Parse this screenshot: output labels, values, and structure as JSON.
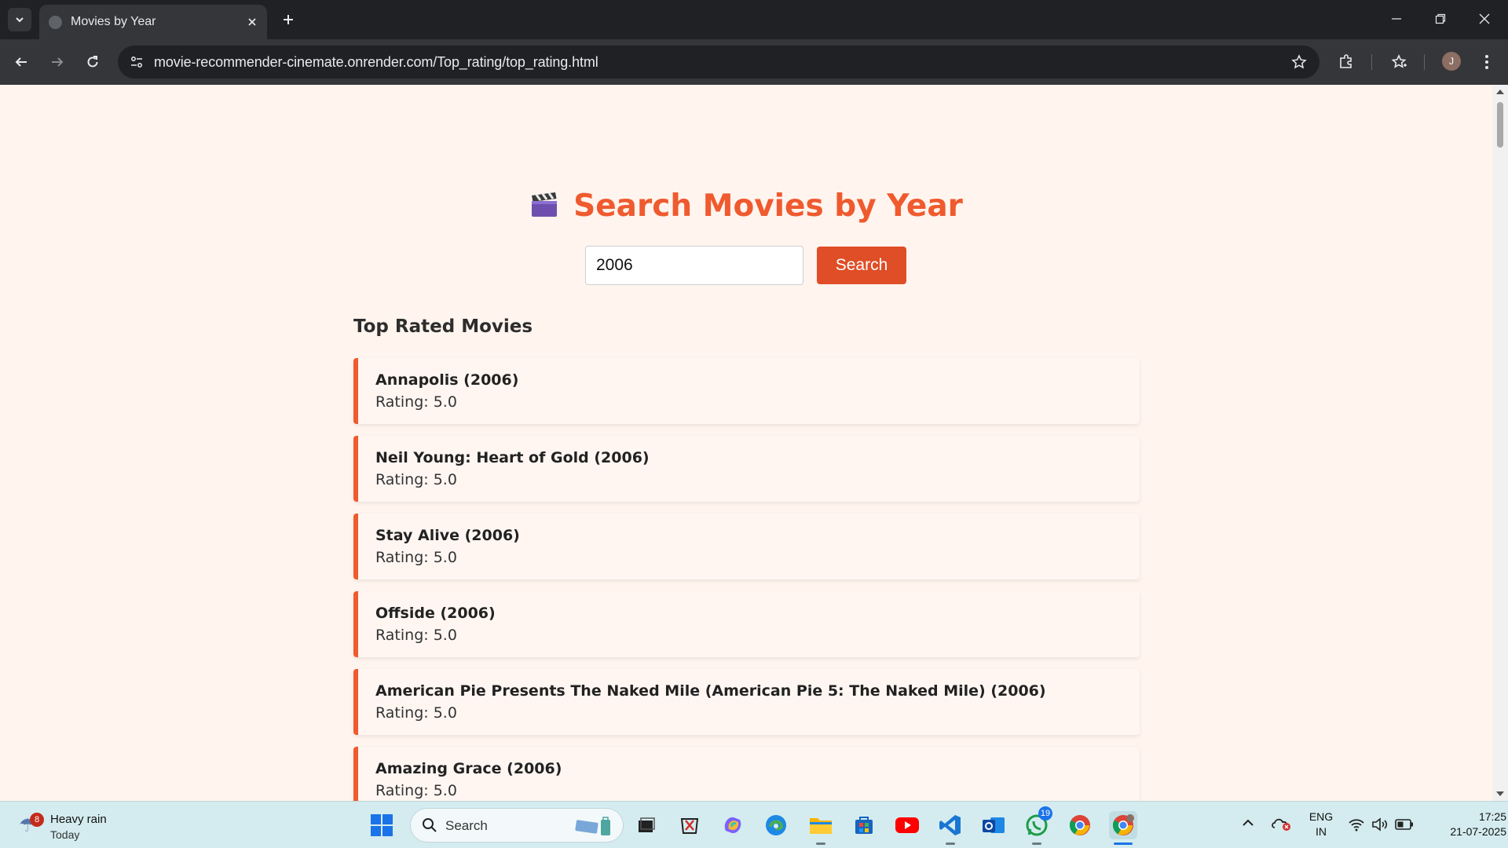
{
  "browser": {
    "tab_title": "Movies by Year",
    "url": "movie-recommender-cinemate.onrender.com/Top_rating/top_rating.html",
    "profile_initial": "J"
  },
  "page": {
    "heading": "Search Movies by Year",
    "heading_icon": "clapper-board-icon",
    "search_value": "2006",
    "search_button": "Search",
    "section_title": "Top Rated Movies",
    "accent_color": "#ef5a2e",
    "button_color": "#df4e26",
    "background_color": "#fff4ee",
    "movies": [
      {
        "title": "Annapolis (2006)",
        "rating": "Rating: 5.0"
      },
      {
        "title": "Neil Young: Heart of Gold (2006)",
        "rating": "Rating: 5.0"
      },
      {
        "title": "Stay Alive (2006)",
        "rating": "Rating: 5.0"
      },
      {
        "title": "Offside (2006)",
        "rating": "Rating: 5.0"
      },
      {
        "title": "American Pie Presents The Naked Mile (American Pie 5: The Naked Mile) (2006)",
        "rating": "Rating: 5.0"
      },
      {
        "title": "Amazing Grace (2006)",
        "rating": "Rating: 5.0"
      }
    ]
  },
  "taskbar": {
    "weather_badge": "8",
    "weather_title": "Heavy rain",
    "weather_sub": "Today",
    "search_label": "Search",
    "whatsapp_badge": "19",
    "lang_top": "ENG",
    "lang_bottom": "IN",
    "time": "17:25",
    "date": "21-07-2025"
  }
}
